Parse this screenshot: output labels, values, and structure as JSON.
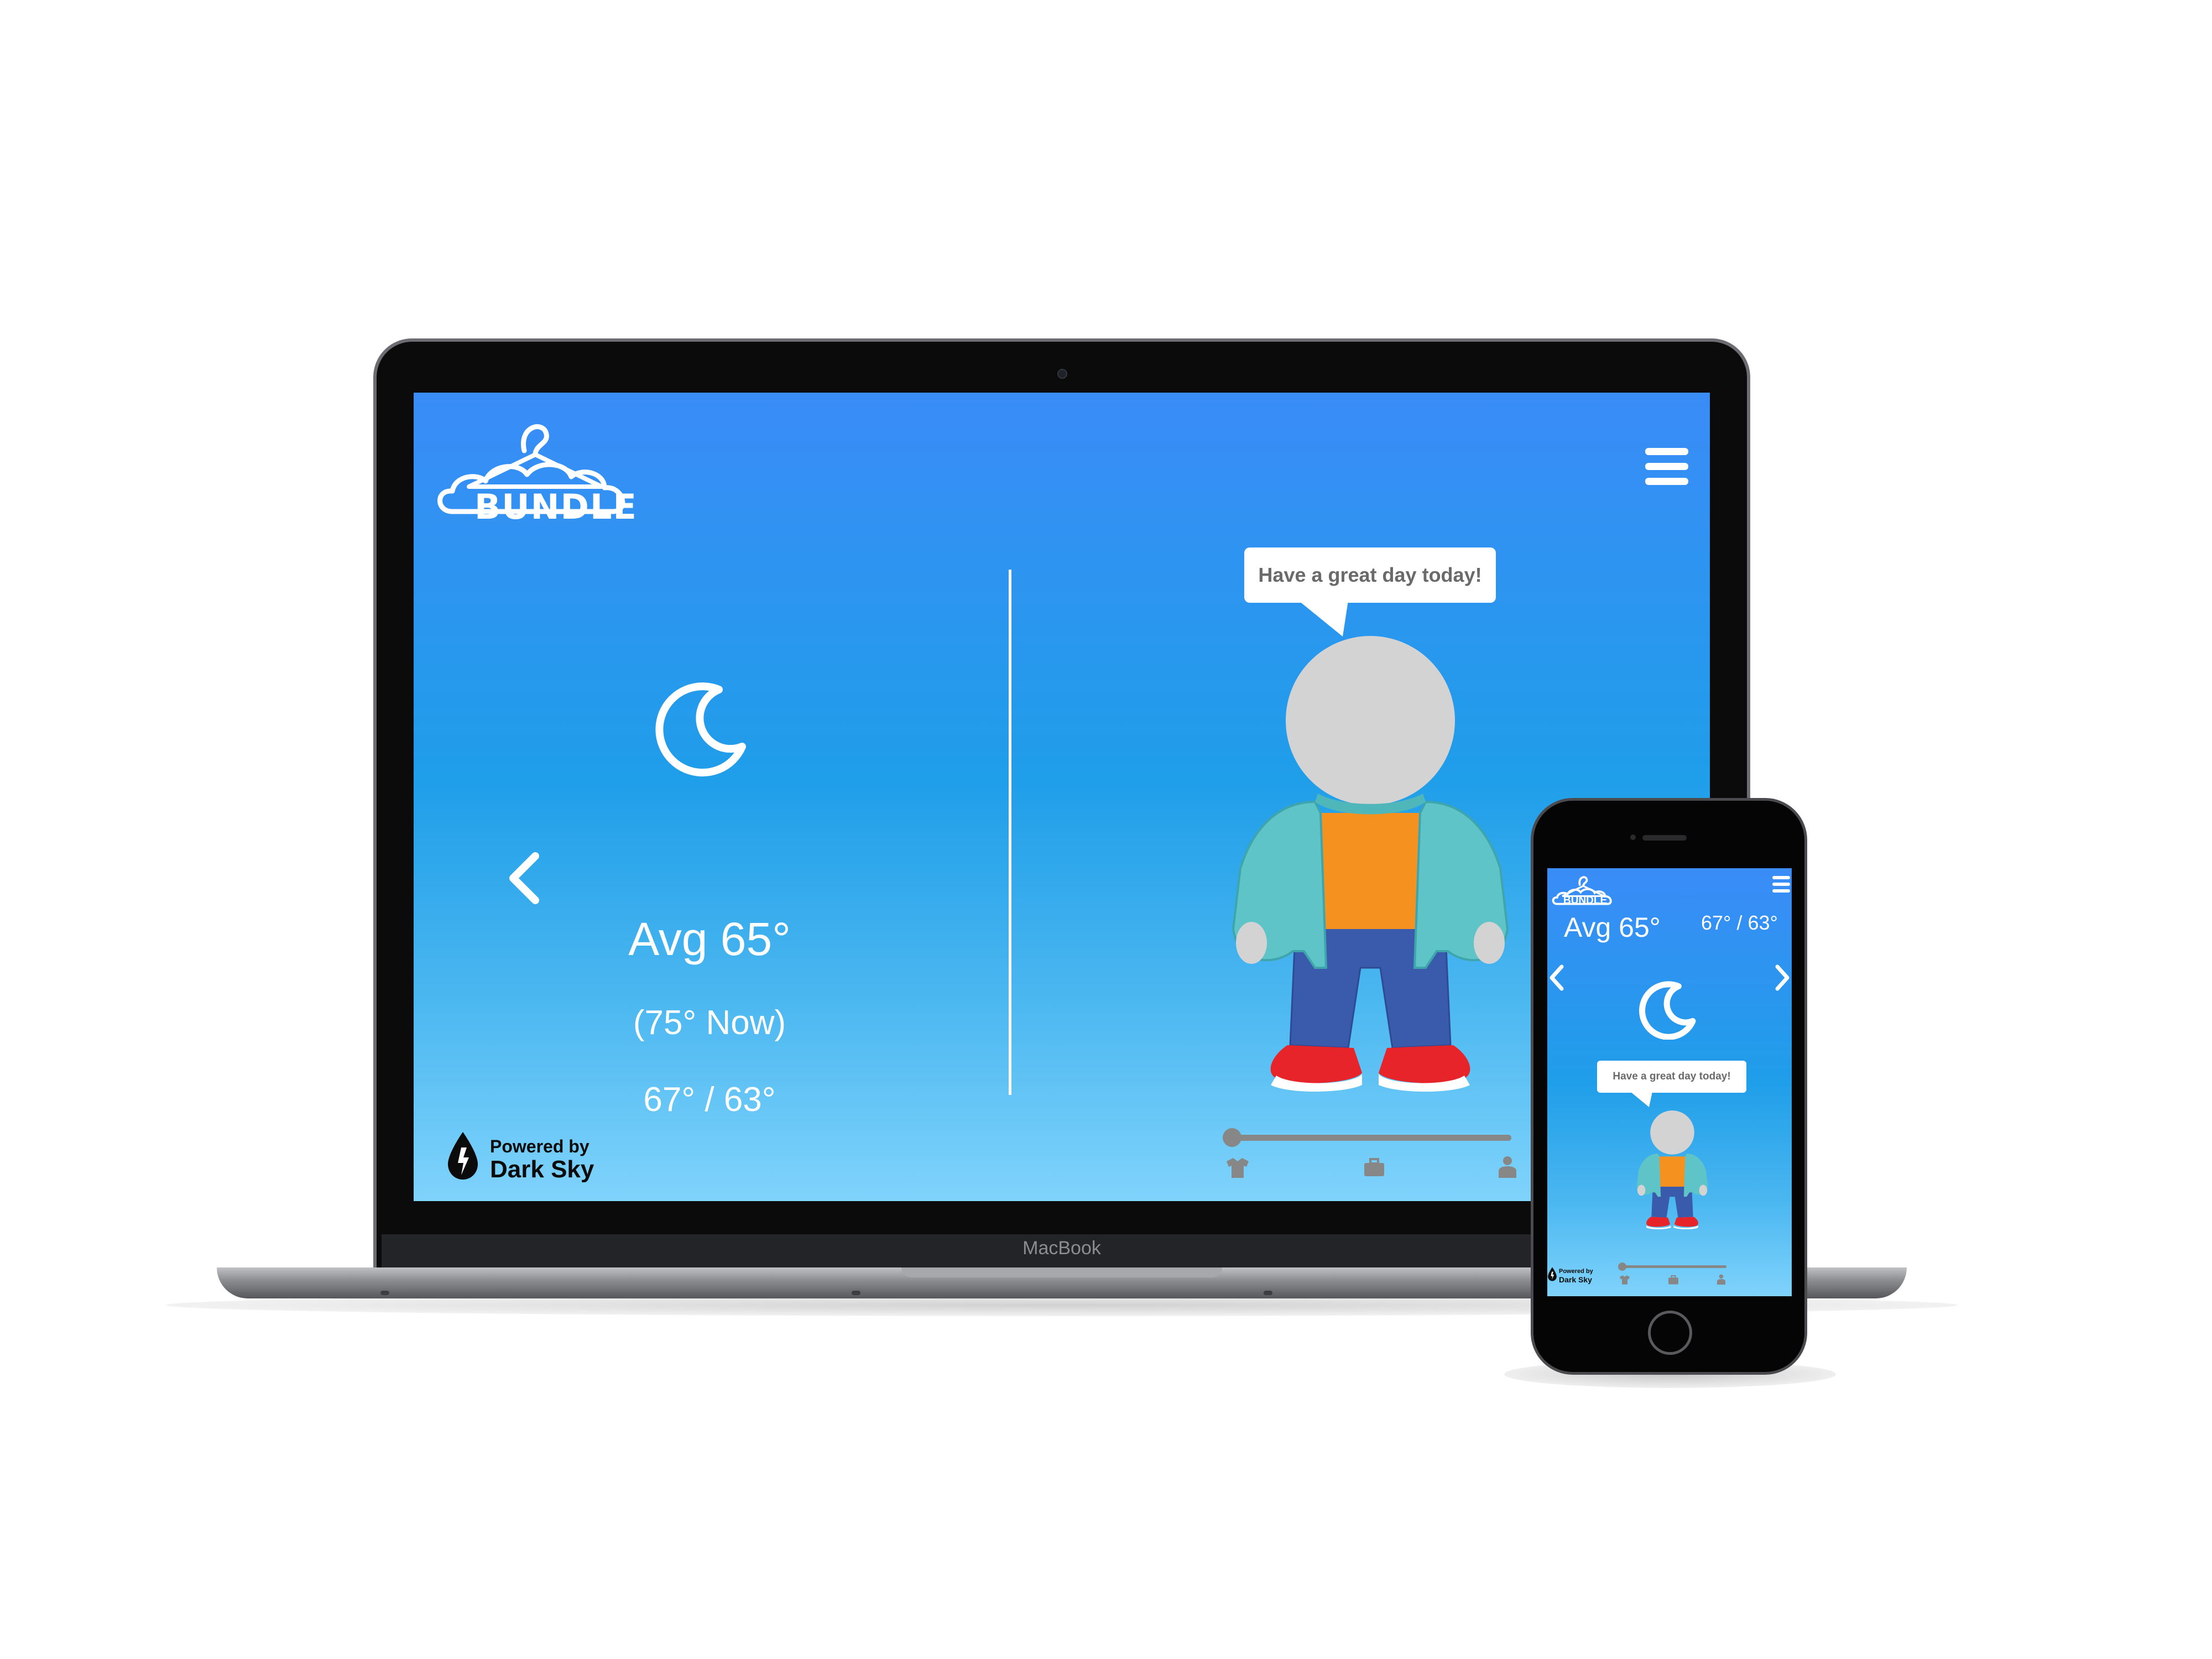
{
  "app": {
    "name": "BUNDLE"
  },
  "weather": {
    "avg": "Avg 65°",
    "now": "(75° Now)",
    "hi_lo": "67° / 63°"
  },
  "outfit": {
    "message": "Have a great day today!"
  },
  "slider": {
    "level": 0,
    "options": [
      "casual-shirt-icon",
      "work-briefcase-icon",
      "formal-suit-icon"
    ]
  },
  "attribution": {
    "line1": "Powered by",
    "line2": "Dark Sky"
  },
  "device": {
    "laptop_brand": "MacBook"
  },
  "colors": {
    "sky_top": "#3a8cf7",
    "sky_bottom": "#7fd3fb",
    "jacket": "#5fc4c7",
    "shirt": "#f5921f",
    "pants": "#3a5aab",
    "shoes": "#e8242b",
    "head": "#d3d3d3"
  }
}
